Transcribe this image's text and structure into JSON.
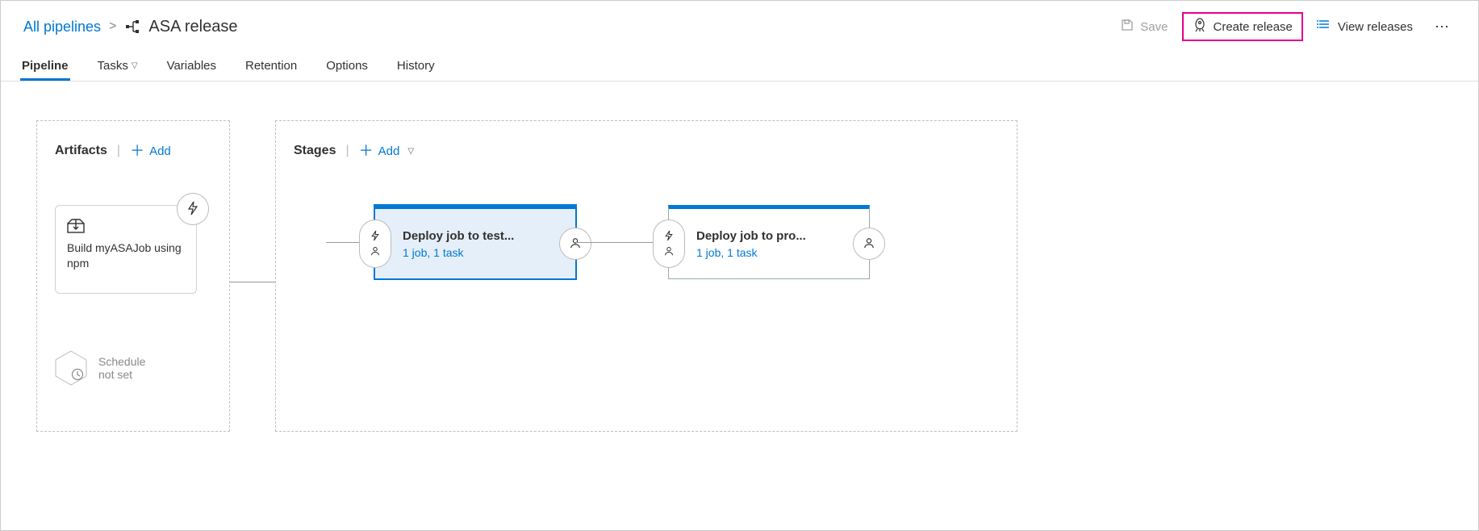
{
  "header": {
    "breadcrumb_root": "All pipelines",
    "title": "ASA release",
    "save_label": "Save",
    "create_release_label": "Create release",
    "view_releases_label": "View releases"
  },
  "tabs": [
    {
      "label": "Pipeline",
      "active": true
    },
    {
      "label": "Tasks",
      "has_dropdown": true
    },
    {
      "label": "Variables"
    },
    {
      "label": "Retention"
    },
    {
      "label": "Options"
    },
    {
      "label": "History"
    }
  ],
  "artifacts": {
    "heading": "Artifacts",
    "add_label": "Add",
    "card_title": "Build myASAJob using npm",
    "schedule_label_1": "Schedule",
    "schedule_label_2": "not set"
  },
  "stages": {
    "heading": "Stages",
    "add_label": "Add",
    "items": [
      {
        "name": "Deploy job to test...",
        "sub": "1 job, 1 task",
        "selected": true
      },
      {
        "name": "Deploy job to pro...",
        "sub": "1 job, 1 task",
        "selected": false
      }
    ]
  }
}
